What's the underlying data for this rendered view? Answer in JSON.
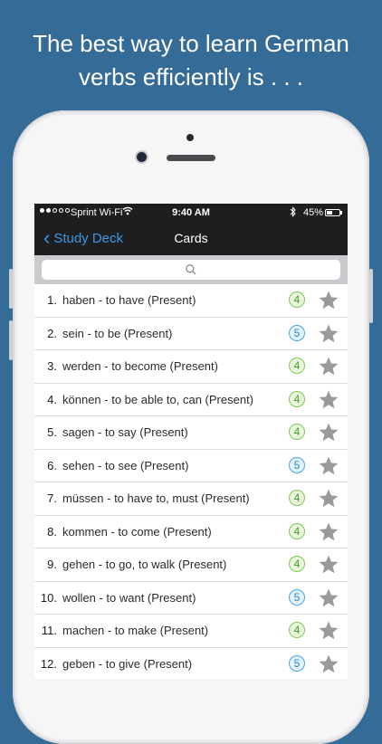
{
  "headline": {
    "line1": "The best way to learn German",
    "line2": "verbs efficiently is . . ."
  },
  "status_bar": {
    "carrier": "Sprint Wi-Fi",
    "time": "9:40 AM",
    "battery": "45%",
    "battery_level": 0.45
  },
  "nav": {
    "back_label": "Study Deck",
    "title": "Cards"
  },
  "colors": {
    "accent": "#3a98e6",
    "badge_green": "#7fc85a",
    "badge_blue": "#4aa6e3",
    "star_gray": "#9a9a9a"
  },
  "cards": [
    {
      "num": "1.",
      "label": "haben - to have (Present)",
      "level": "4",
      "color": "green"
    },
    {
      "num": "2.",
      "label": "sein - to be (Present)",
      "level": "5",
      "color": "blue"
    },
    {
      "num": "3.",
      "label": "werden - to become (Present)",
      "level": "4",
      "color": "green"
    },
    {
      "num": "4.",
      "label": "können - to be able to, can (Present)",
      "level": "4",
      "color": "green"
    },
    {
      "num": "5.",
      "label": "sagen - to say (Present)",
      "level": "4",
      "color": "green"
    },
    {
      "num": "6.",
      "label": "sehen - to see (Present)",
      "level": "5",
      "color": "blue"
    },
    {
      "num": "7.",
      "label": "müssen - to have to, must (Present)",
      "level": "4",
      "color": "green"
    },
    {
      "num": "8.",
      "label": "kommen - to come (Present)",
      "level": "4",
      "color": "green"
    },
    {
      "num": "9.",
      "label": "gehen - to go, to walk (Present)",
      "level": "4",
      "color": "green"
    },
    {
      "num": "10.",
      "label": "wollen - to want (Present)",
      "level": "5",
      "color": "blue"
    },
    {
      "num": "11.",
      "label": "machen - to make (Present)",
      "level": "4",
      "color": "green"
    },
    {
      "num": "12.",
      "label": "geben - to give (Present)",
      "level": "5",
      "color": "blue"
    }
  ]
}
